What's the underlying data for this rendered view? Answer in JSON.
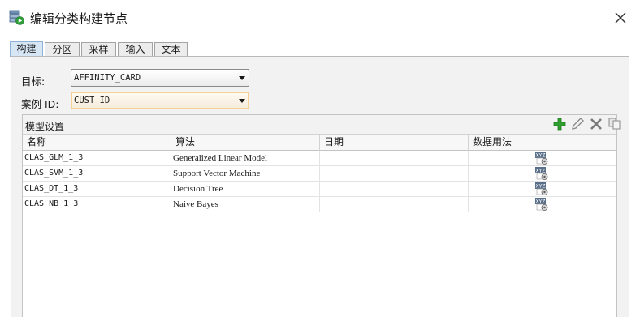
{
  "window": {
    "title": "编辑分类构建节点",
    "icon": "build-node-icon",
    "close_icon": "close-icon"
  },
  "tabs": [
    {
      "label": "构建",
      "active": true
    },
    {
      "label": "分区",
      "active": false
    },
    {
      "label": "采样",
      "active": false
    },
    {
      "label": "输入",
      "active": false
    },
    {
      "label": "文本",
      "active": false
    }
  ],
  "form": {
    "target_label": "目标:",
    "target_value": "AFFINITY_CARD",
    "case_id_label": "案例 ID:",
    "case_id_value": "CUST_ID"
  },
  "model_settings": {
    "title": "模型设置",
    "toolbar": [
      "add-icon",
      "edit-icon",
      "delete-icon",
      "copy-icon"
    ],
    "columns": [
      "名称",
      "算法",
      "日期",
      "数据用法"
    ],
    "rows": [
      {
        "name": "CLAS_GLM_1_3",
        "algorithm": "Generalized Linear Model",
        "date": "",
        "usage_icon": "xml-settings-icon"
      },
      {
        "name": "CLAS_SVM_1_3",
        "algorithm": "Support Vector Machine",
        "date": "",
        "usage_icon": "xml-settings-icon"
      },
      {
        "name": "CLAS_DT_1_3",
        "algorithm": "Decision Tree",
        "date": "",
        "usage_icon": "xml-settings-icon"
      },
      {
        "name": "CLAS_NB_1_3",
        "algorithm": "Naive Bayes",
        "date": "",
        "usage_icon": "xml-settings-icon"
      }
    ]
  },
  "colors": {
    "active_tab": "#d6e6f5",
    "focus_border": "#e0a345",
    "add_green": "#2fa02f",
    "delete_gray": "#7a7a7a"
  }
}
